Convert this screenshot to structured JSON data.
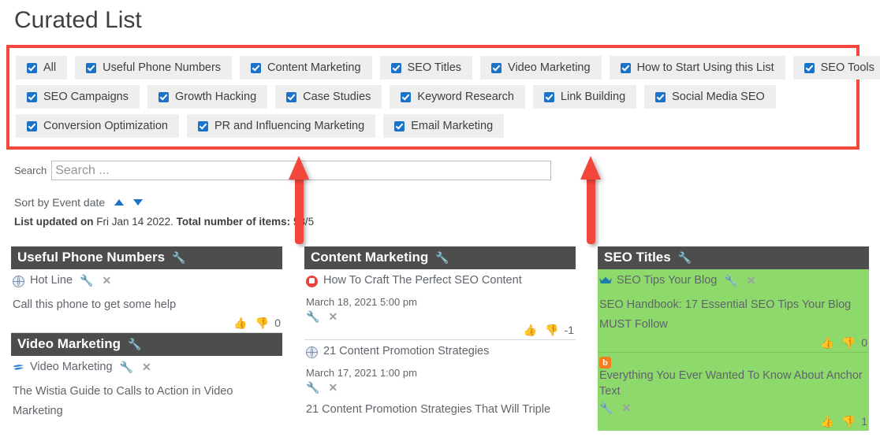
{
  "page": {
    "title": "Curated List"
  },
  "filters": {
    "rows": [
      [
        {
          "label": "All",
          "checked": true
        },
        {
          "label": "Useful Phone Numbers",
          "checked": true
        },
        {
          "label": "Content Marketing",
          "checked": true
        },
        {
          "label": "SEO Titles",
          "checked": true
        },
        {
          "label": "Video Marketing",
          "checked": true
        },
        {
          "label": "How to Start Using this List",
          "checked": true
        },
        {
          "label": "SEO Tools",
          "checked": true
        }
      ],
      [
        {
          "label": "SEO Campaigns",
          "checked": true
        },
        {
          "label": "Growth Hacking",
          "checked": true
        },
        {
          "label": "Case Studies",
          "checked": true
        },
        {
          "label": "Keyword Research",
          "checked": true
        },
        {
          "label": "Link Building",
          "checked": true
        },
        {
          "label": "Social Media SEO",
          "checked": true
        }
      ],
      [
        {
          "label": "Conversion Optimization",
          "checked": true
        },
        {
          "label": "PR and Influencing Marketing",
          "checked": true
        },
        {
          "label": "Email Marketing",
          "checked": true
        }
      ]
    ],
    "highlight_color": "#f4473c"
  },
  "search": {
    "label": "Search",
    "placeholder": "Search ...",
    "value": ""
  },
  "sort": {
    "label": "Sort by Event date",
    "asc_icon": "triangle-up-icon",
    "desc_icon": "triangle-down-icon"
  },
  "meta": {
    "updated_label": "List updated on",
    "updated_value": "Fri Jan 14 2022.",
    "total_label": "Total number of items:",
    "total_value": "53/5"
  },
  "annotations": {
    "arrow_color": "#f4473c",
    "arrows": [
      "up-arrow-annotation-1",
      "up-arrow-annotation-2"
    ]
  },
  "columns": [
    {
      "cards": [
        {
          "header": "Useful Phone Numbers",
          "header_icon": "wrench-icon",
          "green": false,
          "entries": [
            {
              "icon": "globe-icon",
              "title": "Hot Line",
              "date": "",
              "desc": "Call this phone to get some help",
              "tools": false,
              "votes": {
                "up": "thumbs-up-icon",
                "down": "thumbs-down-icon",
                "count": "0"
              },
              "separator": true
            }
          ]
        },
        {
          "header": "Video Marketing",
          "header_icon": "wrench-icon",
          "green": false,
          "entries": [
            {
              "icon": "wistia-icon",
              "title": "Video Marketing",
              "date": "",
              "desc": "The Wistia Guide to Calls to Action in Video Marketing",
              "tools": false,
              "votes": null,
              "separator": false
            }
          ]
        }
      ]
    },
    {
      "cards": [
        {
          "header": "Content Marketing",
          "header_icon": "wrench-icon",
          "green": false,
          "entries": [
            {
              "icon": "red-tag-icon",
              "title": "How To Craft The Perfect SEO Content",
              "date": "March 18, 2021 5:00 pm",
              "desc": "",
              "tools": true,
              "votes": {
                "up": "thumbs-up-icon",
                "down": "thumbs-down-icon",
                "count": "-1"
              },
              "separator": true
            },
            {
              "icon": "globe-icon",
              "title": "21 Content Promotion Strategies",
              "date": "March 17, 2021 1:00 pm",
              "desc": "21 Content Promotion Strategies That Will Triple",
              "tools": true,
              "votes": null,
              "separator": false
            }
          ]
        }
      ]
    },
    {
      "cards": [
        {
          "header": "SEO Titles",
          "header_icon": "wrench-icon",
          "green": true,
          "entries": [
            {
              "icon": "crown-icon",
              "title": "SEO Tips Your Blog",
              "date": "",
              "desc": "SEO Handbook: 17 Essential SEO Tips Your Blog MUST Follow",
              "tools": false,
              "votes": {
                "up": "thumbs-up-icon",
                "down": "thumbs-down-icon",
                "count": "0"
              },
              "separator": true
            },
            {
              "icon": "blogger-icon",
              "title": "Everything You Ever Wanted To Know About Anchor Text",
              "date": "",
              "desc": "",
              "tools": true,
              "votes": {
                "up": "thumbs-up-icon",
                "down": "thumbs-down-icon",
                "count": "1"
              },
              "separator": false
            }
          ]
        }
      ]
    }
  ],
  "glyphs": {
    "wrench": "🔧",
    "close": "✕",
    "thumb_up": "👍",
    "thumb_down": "👎"
  }
}
